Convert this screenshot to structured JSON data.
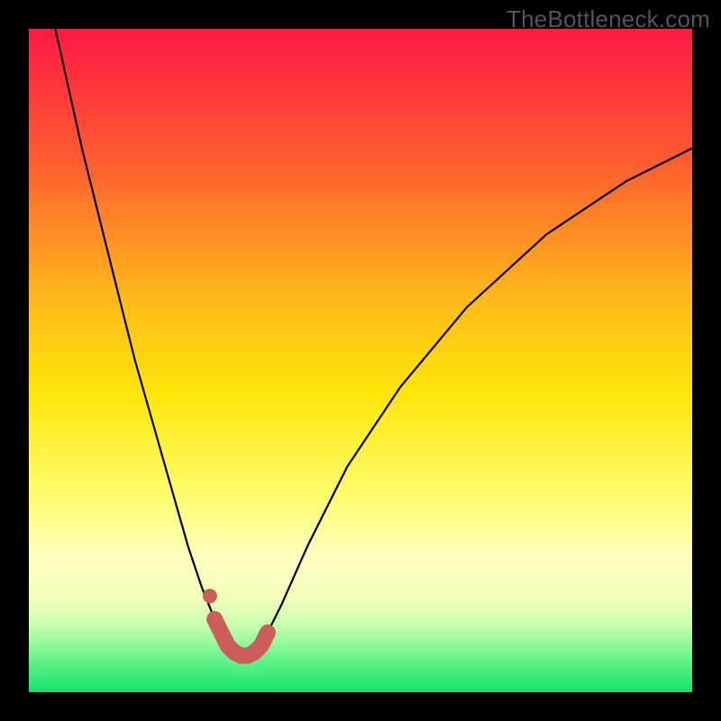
{
  "watermark": "TheBottleneck.com",
  "colors": {
    "background": "#000000",
    "gradient_top": "#ff1a44",
    "gradient_bottom": "#14e36b",
    "curve": "#000000",
    "marker": "#cd5c5c"
  },
  "chart_data": {
    "type": "line",
    "title": "",
    "xlabel": "",
    "ylabel": "",
    "xlim": [
      0,
      100
    ],
    "ylim": [
      0,
      100
    ],
    "annotations": [
      "TheBottleneck.com"
    ],
    "series": [
      {
        "name": "bottleneck-curve",
        "x": [
          4,
          6,
          8,
          10,
          12,
          14,
          16,
          18,
          20,
          22,
          24,
          26,
          28,
          29,
          30,
          31,
          32,
          33,
          34,
          35,
          36,
          38,
          42,
          48,
          56,
          66,
          78,
          90,
          100
        ],
        "values": [
          100,
          91,
          82,
          74,
          66,
          58,
          50,
          43,
          36,
          29,
          22,
          16,
          11,
          9,
          7,
          6,
          5.5,
          5.5,
          6,
          7,
          9,
          13,
          22,
          34,
          46,
          58,
          69,
          77,
          82
        ]
      },
      {
        "name": "highlight-band",
        "x": [
          28,
          29,
          30,
          31,
          32,
          33,
          34,
          35,
          36
        ],
        "values": [
          11,
          9,
          7,
          6,
          5.5,
          5.5,
          6,
          7,
          9
        ]
      },
      {
        "name": "highlight-dot",
        "x": [
          27.3
        ],
        "values": [
          14.5
        ]
      }
    ]
  }
}
